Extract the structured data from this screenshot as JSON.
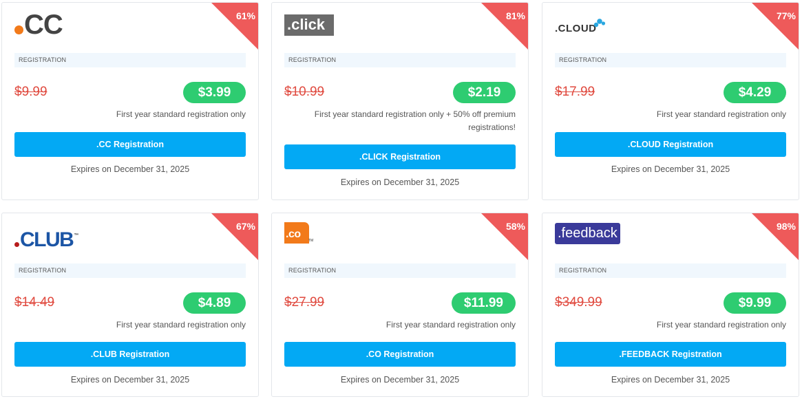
{
  "cards": [
    {
      "logo": ".CC",
      "logo_text": "CC",
      "discount": "61%",
      "section_label": "REGISTRATION",
      "old_price": "$9.99",
      "new_price": "$3.99",
      "note": "First year standard registration only",
      "button_label": ".CC Registration",
      "expires": "Expires on December 31, 2025"
    },
    {
      "logo": ".click",
      "logo_text": ".click",
      "discount": "81%",
      "section_label": "REGISTRATION",
      "old_price": "$10.99",
      "new_price": "$2.19",
      "note": "First year standard registration only + 50% off premium registrations!",
      "button_label": ".CLICK Registration",
      "expires": "Expires on December 31, 2025"
    },
    {
      "logo": ".CLOUD",
      "logo_text": ".CLOUD",
      "discount": "77%",
      "section_label": "REGISTRATION",
      "old_price": "$17.99",
      "new_price": "$4.29",
      "note": "First year standard registration only",
      "button_label": ".CLOUD Registration",
      "expires": "Expires on December 31, 2025"
    },
    {
      "logo": ".CLUB",
      "logo_text": "CLUB",
      "logo_tm": "™",
      "discount": "67%",
      "section_label": "REGISTRATION",
      "old_price": "$14.49",
      "new_price": "$4.89",
      "note": "First year standard registration only",
      "button_label": ".CLUB Registration",
      "expires": "Expires on December 31, 2025"
    },
    {
      "logo": ".co",
      "logo_text": ".co",
      "logo_tm": "TM",
      "discount": "58%",
      "section_label": "REGISTRATION",
      "old_price": "$27.99",
      "new_price": "$11.99",
      "note": "First year standard registration only",
      "button_label": ".CO Registration",
      "expires": "Expires on December 31, 2025"
    },
    {
      "logo": ".feedback",
      "logo_text": ".feedback",
      "discount": "98%",
      "section_label": "REGISTRATION",
      "old_price": "$349.99",
      "new_price": "$9.99",
      "note": "First year standard registration only",
      "button_label": ".FEEDBACK Registration",
      "expires": "Expires on December 31, 2025"
    }
  ],
  "colors": {
    "discount_corner": "#ee5a5a",
    "new_price_pill": "#2ecc71",
    "old_price": "#e04a3f",
    "button": "#03a9f4",
    "registration_bar": "#f0f7fd"
  }
}
